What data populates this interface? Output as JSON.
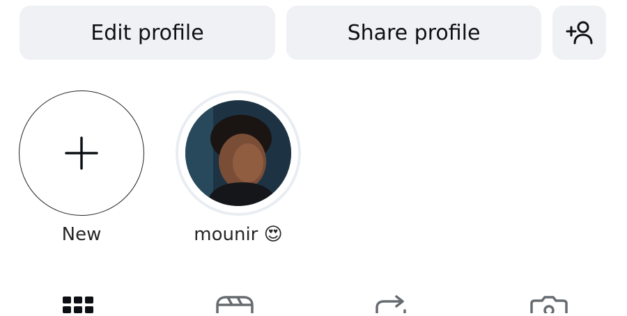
{
  "actions": {
    "edit_profile": "Edit profile",
    "share_profile": "Share profile",
    "add_person_icon": "person-add-icon"
  },
  "highlights": [
    {
      "label": "New",
      "icon": "plus-icon"
    },
    {
      "label": "mounir 😍",
      "icon": "highlight-photo"
    }
  ],
  "tabs": [
    {
      "icon": "grid-icon"
    },
    {
      "icon": "reels-icon"
    },
    {
      "icon": "repost-icon"
    },
    {
      "icon": "tagged-icon"
    }
  ]
}
